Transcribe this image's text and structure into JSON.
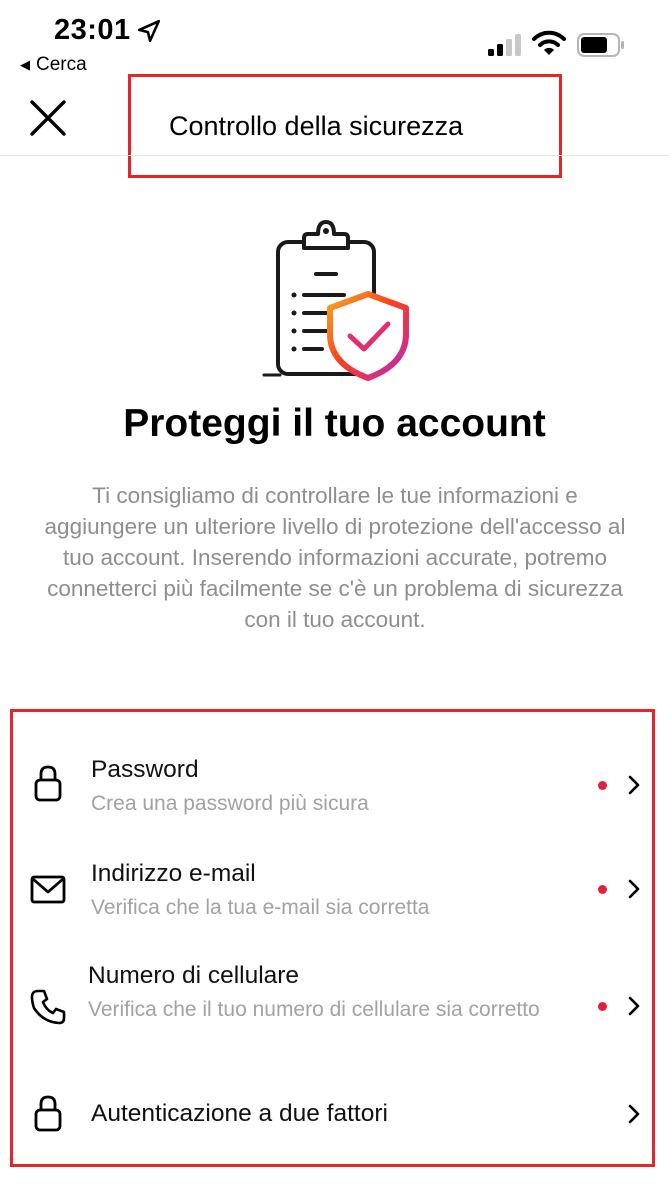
{
  "status_bar": {
    "time": "23:01",
    "back_app": "Cerca",
    "icons": [
      "location-arrow-icon",
      "signal-icon",
      "wifi-icon",
      "battery-icon"
    ]
  },
  "header": {
    "title": "Controllo della sicurezza",
    "close_icon": "close-icon"
  },
  "illustration": {
    "icon": "clipboard-shield-check-icon"
  },
  "main": {
    "title": "Proteggi il tuo account",
    "description": "Ti consigliamo di controllare le tue informazioni e aggiungere un ulteriore livello di protezione dell'accesso al tuo account. Inserendo informazioni accurate, potremo connetterci più facilmente se c'è un problema di sicurezza con il tuo account."
  },
  "options": [
    {
      "title": "Password",
      "subtitle": "Crea una password più sicura",
      "icon": "lock-icon",
      "alert": true
    },
    {
      "title": "Indirizzo e-mail",
      "subtitle": "Verifica che la tua e-mail sia corretta",
      "icon": "mail-icon",
      "alert": true
    },
    {
      "title": "Numero di cellulare",
      "subtitle": "Verifica che il tuo numero di cellulare sia corretto",
      "icon": "phone-icon",
      "alert": true
    },
    {
      "title": "Autenticazione a due fattori",
      "subtitle": "",
      "icon": "lock-icon",
      "alert": false
    }
  ],
  "colors": {
    "highlight_border": "#e5252a",
    "alert_dot": "#e41e3f",
    "secondary_text": "#8e8e8e"
  }
}
